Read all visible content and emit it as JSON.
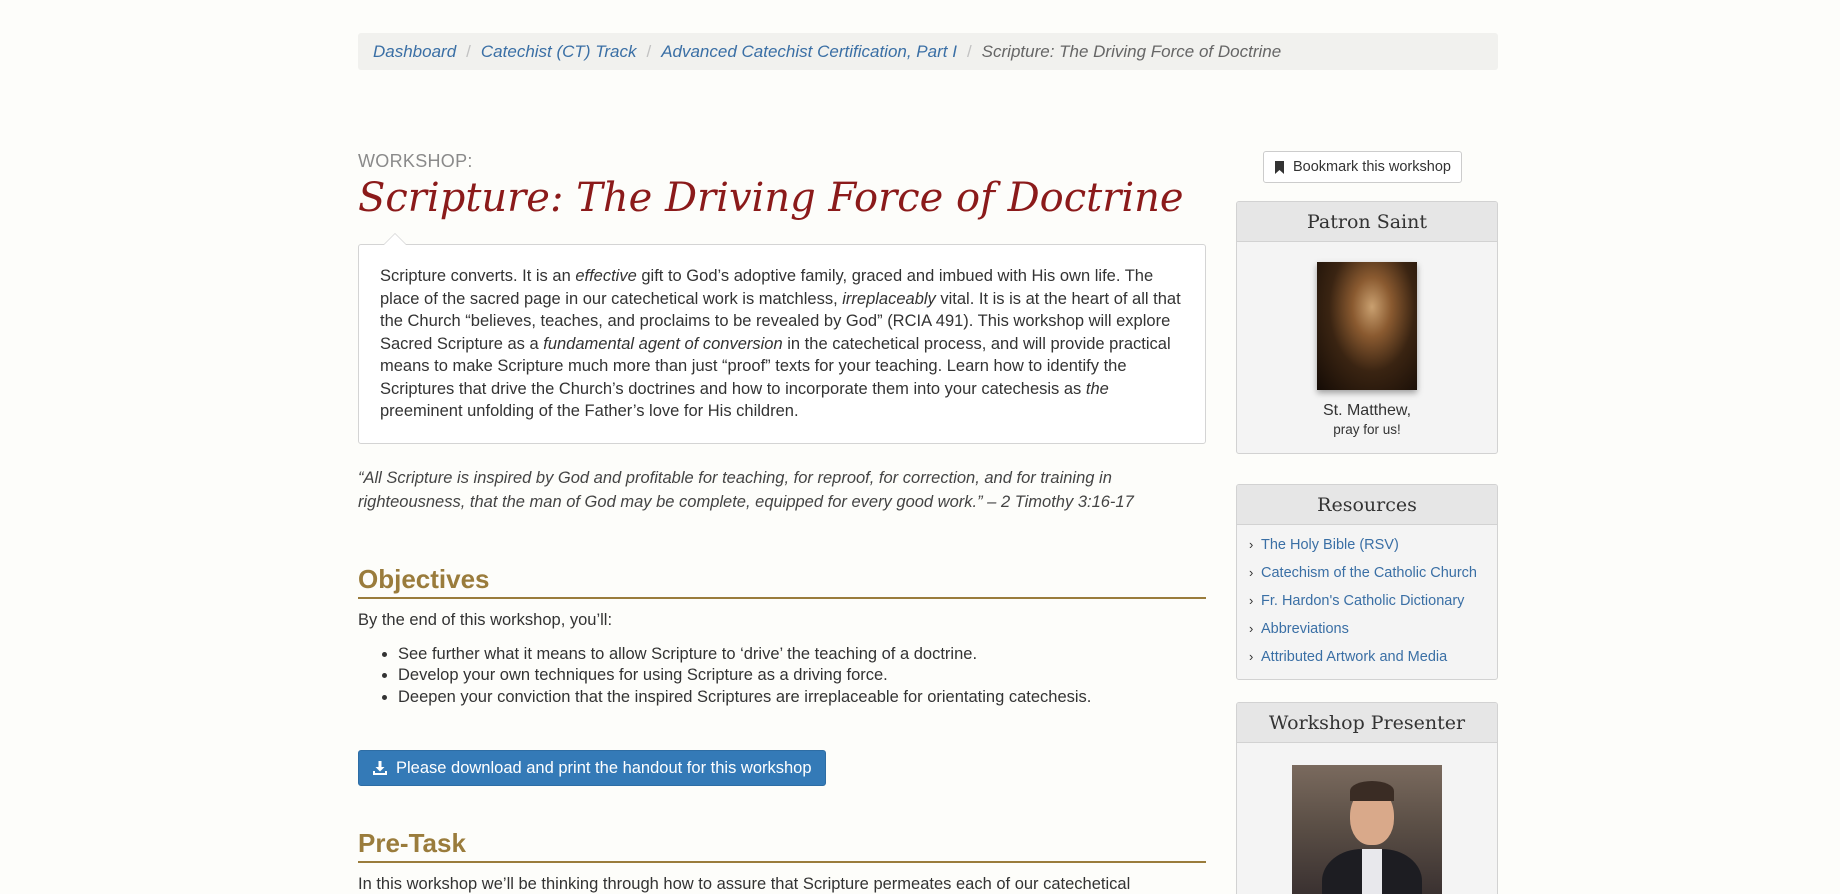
{
  "breadcrumb": {
    "items": [
      "Dashboard",
      "Catechist (CT) Track",
      "Advanced Catechist Certification, Part I"
    ],
    "current": "Scripture: The Driving Force of Doctrine",
    "separator": "/"
  },
  "workshop": {
    "label": "WORKSHOP:",
    "title": "Scripture: The Driving Force of Doctrine"
  },
  "intro": {
    "p1": "Scripture converts.  It is an ",
    "i1": "effective",
    "p2": " gift to God’s adoptive family, graced and imbued with His own life.  The place of the sacred page in our catechetical work is matchless, ",
    "i2": "irreplaceably",
    "p3": " vital.  It is is at the heart of all that the Church “believes, teaches, and proclaims to be revealed by God” (RCIA 491).  This workshop will explore Sacred Scripture as a ",
    "i3": "fundamental agent of conversion",
    "p4": " in the catechetical process, and will provide practical means to make Scripture much more than just “proof” texts for your teaching.  Learn how to identify the Scriptures that drive the Church’s doctrines and how to incorporate them into your catechesis as ",
    "i4": "the",
    "p5": " preeminent unfolding of the Father’s love for His children."
  },
  "quote": "“All Scripture is inspired by God and profitable for teaching, for reproof, for correction, and for training in righteousness, that the man of God may be complete, equipped for every good work.” – 2 Timothy 3:16-17",
  "objectives": {
    "heading": "Objectives",
    "lead": "By the end of this workshop, you’ll:",
    "items": [
      "See further what it means to allow Scripture to ‘drive’ the teaching of a doctrine.",
      "Develop your own techniques for using Scripture as a driving force.",
      "Deepen your conviction that the inspired Scriptures are irreplaceable for orientating catechesis."
    ]
  },
  "download_label": "Please download and print the handout for this workshop",
  "pretask": {
    "heading": "Pre-Task",
    "text": "In this workshop we’ll be thinking through how to assure that Scripture permeates each of our catechetical"
  },
  "sidebar": {
    "bookmark_label": "Bookmark this workshop",
    "patron": {
      "heading": "Patron Saint",
      "name": "St. Matthew,",
      "sub": "pray for us!"
    },
    "resources": {
      "heading": "Resources",
      "items": [
        "The Holy Bible (RSV)",
        "Catechism of the Catholic Church",
        "Fr. Hardon's Catholic Dictionary",
        "Abbreviations",
        "Attributed Artwork and Media"
      ]
    },
    "presenter": {
      "heading": "Workshop Presenter"
    }
  },
  "colors": {
    "title": "#8b1a1a",
    "section": "#9a7c3c",
    "link": "#3a6fa5",
    "button": "#347ab7"
  }
}
